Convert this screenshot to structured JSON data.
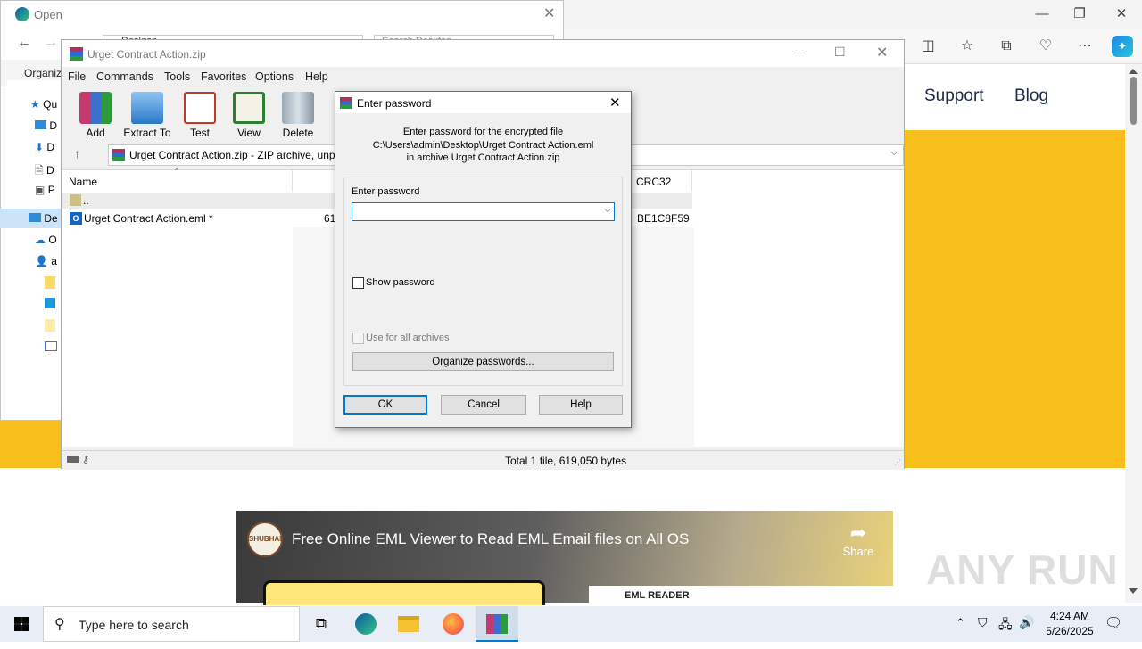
{
  "edge": {
    "tab_title": "Open",
    "nav_support": "Support",
    "nav_blog": "Blog",
    "video_title": "Free Online EML Viewer to Read EML Email files on All OS",
    "share_label": "Share",
    "channel_badge": "SHUBHAM SINGH",
    "card_text": "EML READER",
    "watermark": "ANY RUN"
  },
  "open_dialog": {
    "title": "Open",
    "organize": "Organiz",
    "search_placeholder": "Search Desktop",
    "path": "Desktop",
    "left_items": [
      "Qu",
      "D",
      "D",
      "D",
      "P",
      "De",
      "O",
      "a"
    ]
  },
  "winrar": {
    "title": "Urget Contract Action.zip",
    "menu": [
      "File",
      "Commands",
      "Tools",
      "Favorites",
      "Options",
      "Help"
    ],
    "toolbar": [
      "Add",
      "Extract To",
      "Test",
      "View",
      "Delete"
    ],
    "path_text": "Urget Contract Action.zip - ZIP archive, unp",
    "columns": {
      "name": "Name",
      "crc": "CRC32"
    },
    "rows": [
      {
        "name": "..",
        "size": "",
        "crc": ""
      },
      {
        "name": "Urget Contract Action.eml *",
        "size": "61",
        "crc": "BE1C8F59"
      }
    ],
    "status": "Total 1 file, 619,050 bytes"
  },
  "password_dialog": {
    "title": "Enter password",
    "line1": "Enter password for the encrypted file",
    "line2": "C:\\Users\\admin\\Desktop\\Urget Contract Action.eml",
    "line3": "in archive Urget Contract Action.zip",
    "group_label": "Enter password",
    "password_value": "",
    "show_password": "Show password",
    "use_all": "Use for all archives",
    "organize": "Organize passwords...",
    "ok": "OK",
    "cancel": "Cancel",
    "help": "Help"
  },
  "taskbar": {
    "search_placeholder": "Type here to search",
    "time": "4:24 AM",
    "date": "5/26/2025"
  },
  "colors": {
    "site_yellow": "#f7be1c",
    "taskbar": "#e9eef6",
    "dialog_bg": "#f0f0f0",
    "focus_blue": "#0078d7"
  }
}
